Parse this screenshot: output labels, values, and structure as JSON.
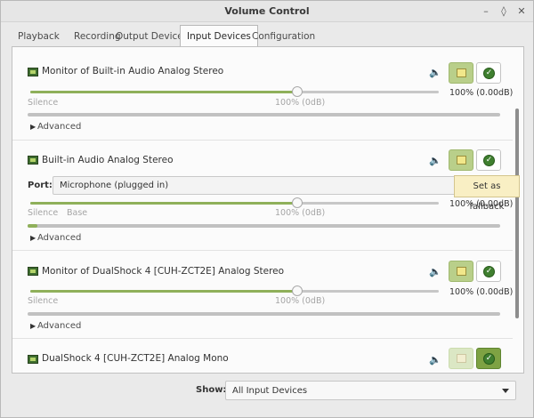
{
  "window": {
    "title": "Volume Control"
  },
  "tabs": [
    {
      "label": "Playback"
    },
    {
      "label": "Recording"
    },
    {
      "label": "Output Devices"
    },
    {
      "label": "Input Devices",
      "active": true
    },
    {
      "label": "Configuration"
    }
  ],
  "devices": [
    {
      "name": "Monitor of Built-in Audio Analog Stereo",
      "volume_percent": 100,
      "volume_text": "100% (0.00dB)",
      "silence_label": "Silence",
      "mark_label": "100% (0dB)",
      "advanced_label": "Advanced",
      "meter_level": 0
    },
    {
      "name": "Built-in Audio Analog Stereo",
      "port_label": "Port:",
      "port_value": "Microphone (plugged in)",
      "volume_percent": 100,
      "volume_text": "100% (0.00dB)",
      "silence_label": "Silence",
      "base_label": "Base",
      "mark_label": "100% (0dB)",
      "advanced_label": "Advanced",
      "meter_level": 0.02
    },
    {
      "name": "Monitor of DualShock 4 [CUH-ZCT2E] Analog Stereo",
      "volume_percent": 100,
      "volume_text": "100% (0.00dB)",
      "silence_label": "Silence",
      "mark_label": "100% (0dB)",
      "advanced_label": "Advanced",
      "meter_level": 0
    },
    {
      "name": "DualShock 4 [CUH-ZCT2E] Analog Mono",
      "is_fallback": true
    }
  ],
  "tooltip": "Set as fallback",
  "footer": {
    "show_label": "Show:",
    "show_value": "All Input Devices"
  },
  "colors": {
    "accent": "#8fb05a",
    "fallback_active": "#7ea243"
  }
}
